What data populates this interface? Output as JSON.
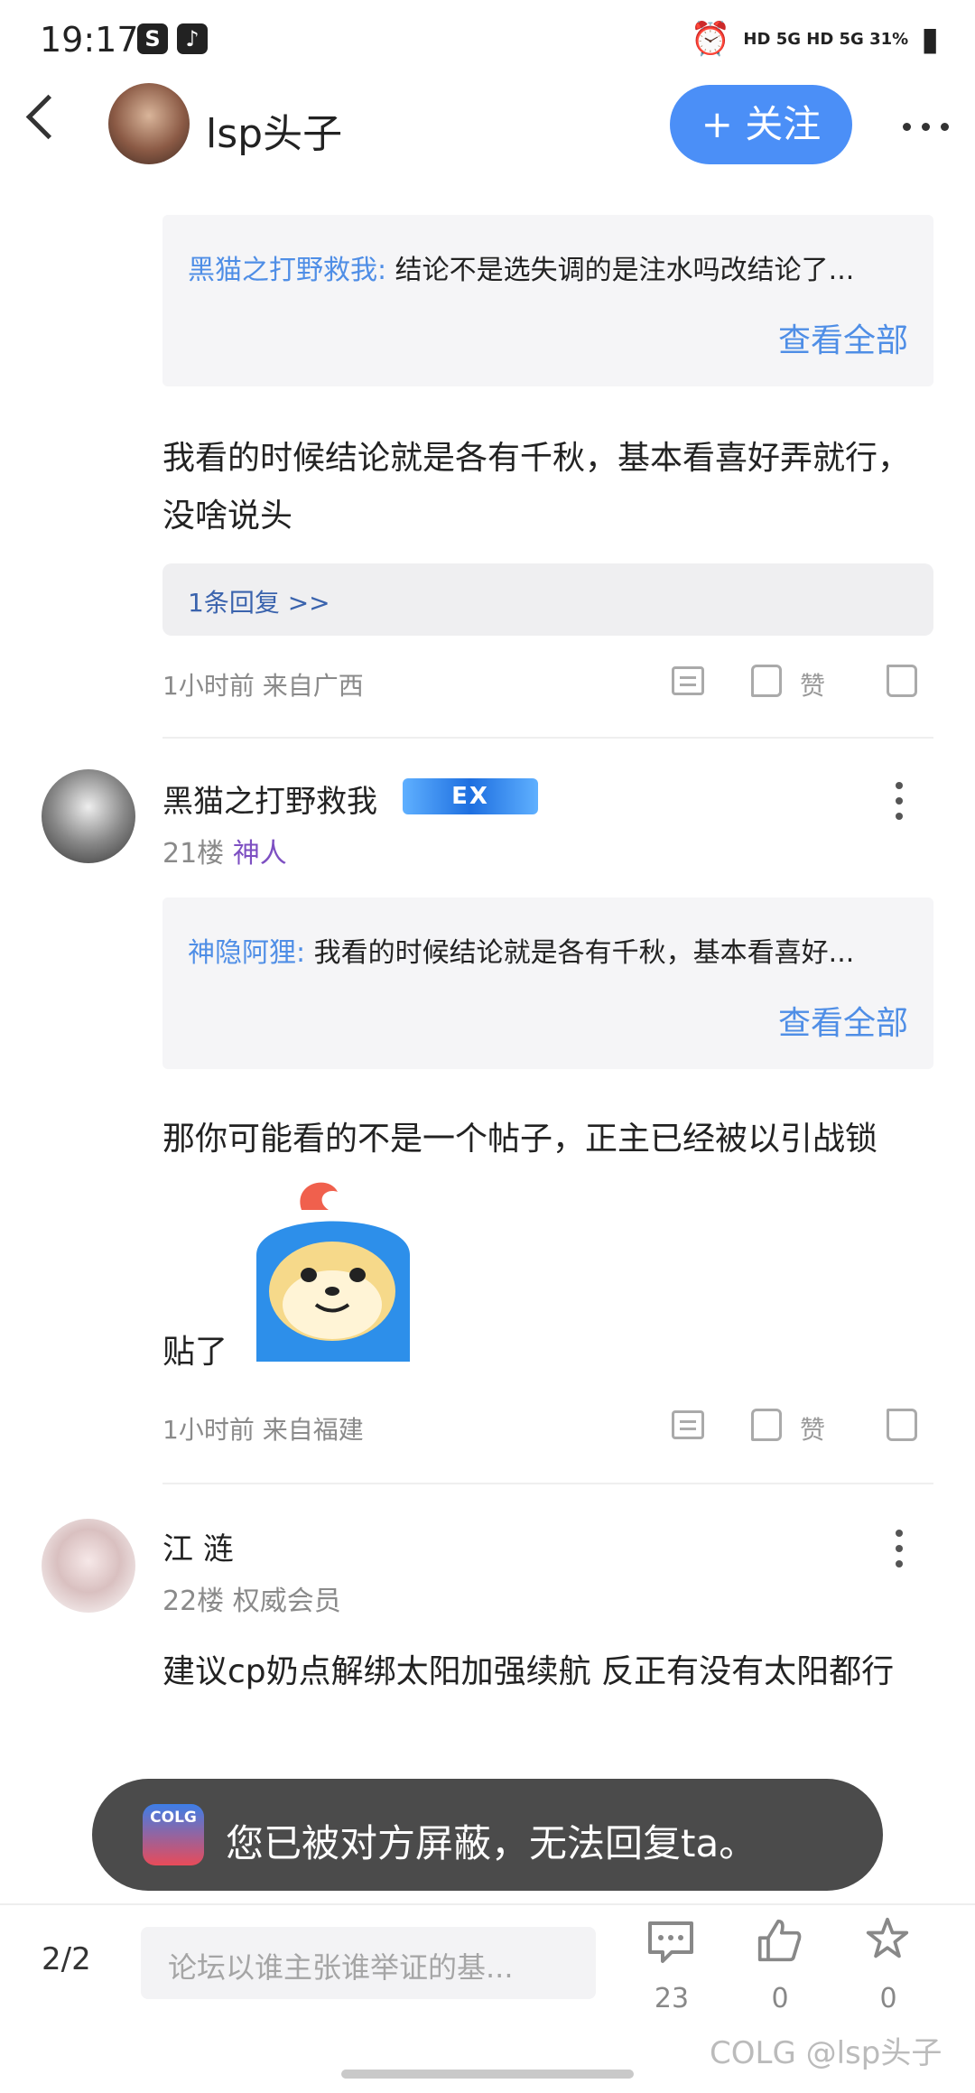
{
  "status": {
    "time": "19:17",
    "right": "HD 5G HD 5G 31%"
  },
  "header": {
    "title": "lsp头子",
    "follow": "+ 关注"
  },
  "quote1": {
    "name": "黑猫之打野救我:",
    "text": "结论不是选失调的是注水吗改结论了...",
    "see_all": "查看全部"
  },
  "post20": {
    "text": "我看的时候结论就是各有千秋，基本看喜好弄就行，没啥说头",
    "reply_count": "1条回复 >>",
    "meta": "1小时前 来自广西",
    "like": "赞"
  },
  "post21": {
    "name": "黑猫之打野救我",
    "badge": "EX",
    "floor": "21楼",
    "title": "神人",
    "quote_name": "神隐阿狸:",
    "quote_text": "我看的时候结论就是各有千秋，基本看喜好...",
    "see_all": "查看全部",
    "text": "那你可能看的不是一个帖子，正主已经被以引战锁",
    "text2": "贴了",
    "meta": "1小时前 来自福建",
    "like": "赞"
  },
  "post22": {
    "name": "江 涟",
    "floor": "22楼",
    "title": "权威会员",
    "text": "建议cp奶点解绑太阳加强续航 反正有没有太阳都行"
  },
  "toast": {
    "logo": "COLG",
    "text": "您已被对方屏蔽，无法回复ta。"
  },
  "bottom": {
    "page": "2/2",
    "placeholder": "论坛以谁主张谁举证的基...",
    "comments": "23",
    "likes": "0",
    "favorites": "0",
    "watermark": "COLG @lsp头子"
  },
  "colors": {
    "accent": "#4b8ff7",
    "link": "#4f8ee6",
    "title_purple": "#7d4fc2"
  }
}
